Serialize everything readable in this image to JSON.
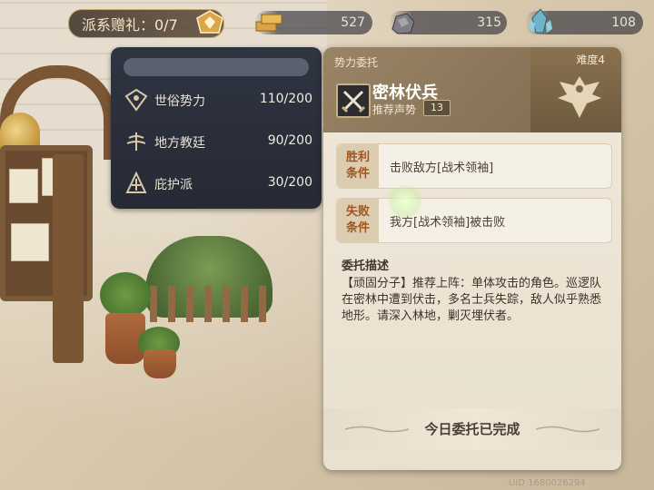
{
  "top_bar": {
    "reward_label": "派系赠礼：0/7",
    "resources": [
      {
        "icon": "gold-bars-icon",
        "value": "527"
      },
      {
        "icon": "ore-icon",
        "value": "315"
      },
      {
        "icon": "crystal-icon",
        "value": "108"
      }
    ]
  },
  "factions": [
    {
      "icon": "secular-faction-icon",
      "name": "世俗势力",
      "value": "110/200"
    },
    {
      "icon": "church-faction-icon",
      "name": "地方教廷",
      "value": "90/200"
    },
    {
      "icon": "protector-faction-icon",
      "name": "庇护派",
      "value": "30/200"
    }
  ],
  "commission": {
    "category": "势力委托",
    "difficulty": "难度4",
    "title": "密林伏兵",
    "recommend_label": "推荐声势",
    "recommend_value": "13",
    "victory_tag": "胜利条件",
    "victory_text": "击败敌方[战术领袖]",
    "defeat_tag": "失败条件",
    "defeat_text": "我方[战术领袖]被击败",
    "desc_title": "委托描述",
    "desc_text": "【顽固分子】推荐上阵：单体攻击的角色。巡逻队在密林中遭到伏击，多名士兵失踪，敌人似乎熟悉地形。请深入林地，剿灭埋伏者。",
    "done_text": "今日委托已完成"
  },
  "uid": "UID 1680026294",
  "colors": {
    "panel_dark": "#2f3441",
    "card_bg": "#efe7d8",
    "condition_tag": "#a2541f",
    "accent_gold": "#c9a86a"
  }
}
